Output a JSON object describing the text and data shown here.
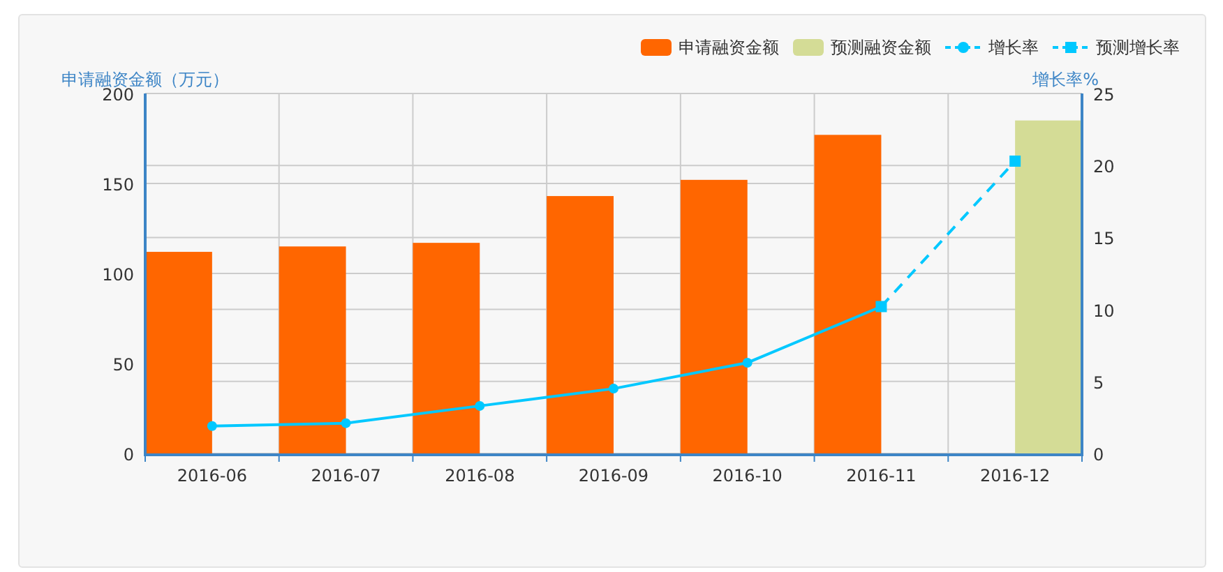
{
  "chart": {
    "chart_data": {
      "type": "bar",
      "grid": true,
      "ylabel": "申请融资金额（万元）",
      "y2label": "增长率%",
      "categories": [
        "2016-06",
        "2016-07",
        "2016-08",
        "2016-09",
        "2016-10",
        "2016-11",
        "2016-12"
      ],
      "ylim": [
        0,
        200
      ],
      "yticks": [
        0,
        50,
        100,
        150,
        200
      ],
      "y2lim": [
        0,
        25
      ],
      "y2ticks": [
        0,
        5,
        10,
        15,
        20,
        25
      ],
      "series": [
        {
          "name": "申请融资金额",
          "type": "bar",
          "color": "#ff6600",
          "values": [
            112,
            115,
            117,
            143,
            152,
            177,
            null
          ]
        },
        {
          "name": "预测融资金额",
          "type": "bar",
          "color": "#d4dc96",
          "values": [
            null,
            null,
            null,
            null,
            null,
            null,
            185
          ]
        },
        {
          "name": "增长率",
          "type": "line",
          "axis": "y2",
          "line_style": "solid",
          "marker": "circle",
          "color": "#00c8ff",
          "values": [
            1.9,
            2.1,
            3.3,
            4.5,
            6.3,
            10.2,
            null
          ]
        },
        {
          "name": "预测增长率",
          "type": "line",
          "axis": "y2",
          "line_style": "dashed",
          "marker": "square",
          "color": "#00c8ff",
          "values": [
            null,
            null,
            null,
            null,
            null,
            10.2,
            20.3
          ]
        }
      ]
    }
  }
}
